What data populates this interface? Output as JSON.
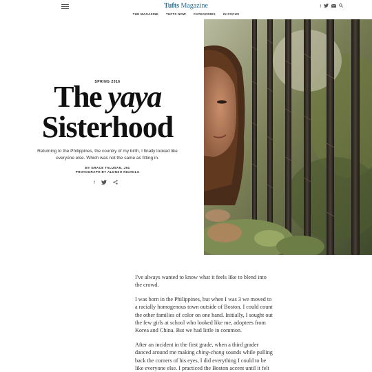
{
  "header": {
    "logo_brand": "Tufts",
    "logo_name": "Magazine",
    "menu_icon": "hamburger-menu-icon",
    "social_icons": [
      "facebook-icon",
      "twitter-icon",
      "email-icon",
      "search-icon"
    ],
    "nav": [
      "THE MAGAZINE",
      "TUFTS NOW",
      "CATEGORIES",
      "IN FOCUS"
    ]
  },
  "hero": {
    "kicker": "SPRING 2016",
    "title_part1": "The",
    "title_part2": "yaya",
    "title_part3": "Sisterhood",
    "dek": "Returning to the Philippines, the country of my birth, I finally looked like everyone else. Which was not the same as fitting in.",
    "byline": "BY GRACE TALUSAN, J94",
    "photo_credit": "PHOTOGRAPH BY ALONSO NICHOLS",
    "share_icons": [
      "facebook-icon",
      "twitter-icon",
      "share-icon"
    ]
  },
  "article": {
    "p1": "I've always wanted to know what it feels like to blend into the crowd.",
    "p2": "I was born in the Philippines, but when I was 3 we moved to a racially homogenous town outside of Boston. I could count the other families of color on one hand. Initially, I sought out the few girls at school who looked like me, adoptees from Korea and China. But we had little in common.",
    "p3_a": "After an incident in the first grade, when a third grader danced around me making ",
    "p3_em": "ching-chong",
    "p3_b": " sounds while pulling back the corners of his eyes, I did everything I could to be like everyone else. I practiced the Boston accent until it felt like"
  }
}
